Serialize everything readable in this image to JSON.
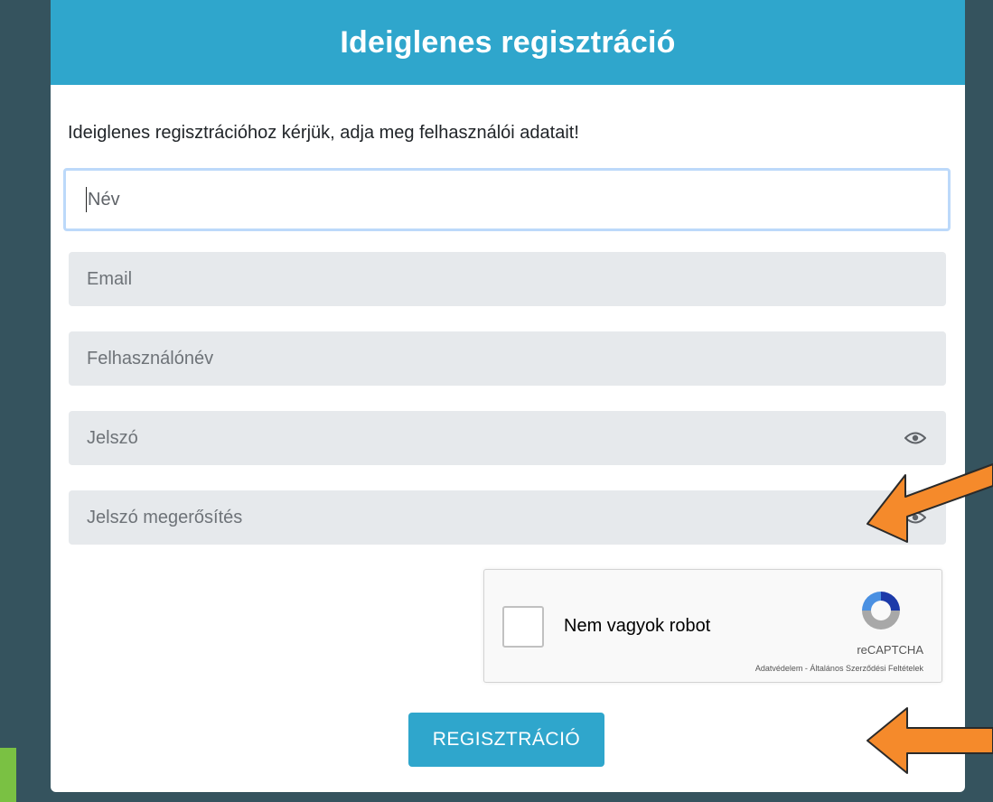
{
  "header": {
    "title": "Ideiglenes regisztráció"
  },
  "instruction": "Ideiglenes regisztrációhoz kérjük, adja meg felhasználói adatait!",
  "fields": {
    "name": {
      "placeholder": "Név",
      "focused": true
    },
    "email": {
      "placeholder": "Email"
    },
    "username": {
      "placeholder": "Felhasználónév"
    },
    "password": {
      "placeholder": "Jelszó",
      "icon": "eye-icon"
    },
    "password_confirm": {
      "placeholder": "Jelszó megerősítés",
      "icon": "eye-icon"
    }
  },
  "recaptcha": {
    "label": "Nem vagyok robot",
    "brand": "reCAPTCHA",
    "links": "Adatvédelem - Általános Szerződési Feltételek",
    "checked": false
  },
  "submit": {
    "label": "REGISZTRÁCIÓ"
  },
  "colors": {
    "background": "#35535e",
    "header": "#2fa6cc",
    "button": "#2fa6cc",
    "annotation_arrow": "#f58a2b",
    "focus_ring": "#bcd9fa"
  },
  "annotations": [
    {
      "type": "arrow",
      "points_to": "password-confirm-eye-icon"
    },
    {
      "type": "arrow",
      "points_to": "register-button"
    }
  ]
}
